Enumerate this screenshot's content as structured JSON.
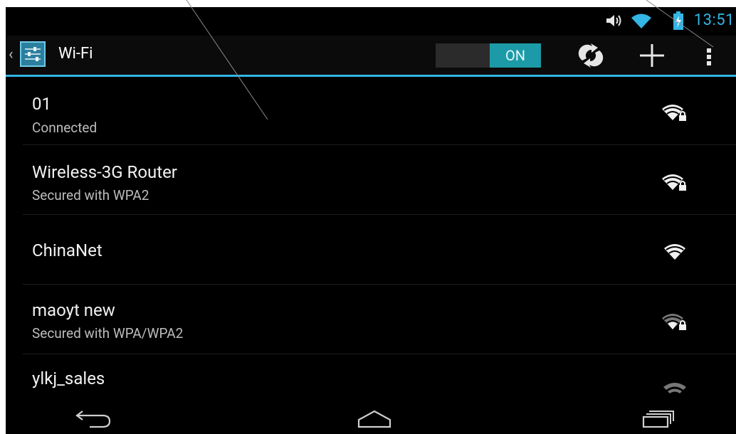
{
  "status_bar": {
    "time": "13:51",
    "icons": [
      "volume-icon",
      "wifi-signal-icon",
      "battery-charging-icon"
    ],
    "accent": "#33b5e5"
  },
  "action_bar": {
    "title": "Wi-Fi",
    "toggle_label": "ON",
    "toggle_state": "on",
    "buttons": [
      "wps-icon",
      "add-network-icon",
      "overflow-menu-icon"
    ]
  },
  "networks": [
    {
      "name": "01",
      "status": "Connected",
      "secured": true,
      "signal": "strong"
    },
    {
      "name": "Wireless-3G Router",
      "status": "Secured with WPA2",
      "secured": true,
      "signal": "strong"
    },
    {
      "name": "ChinaNet",
      "status": "",
      "secured": false,
      "signal": "strong"
    },
    {
      "name": "maoyt new",
      "status": "Secured with WPA/WPA2",
      "secured": true,
      "signal": "medium"
    },
    {
      "name": "ylkj_sales",
      "status": "",
      "secured": false,
      "signal": "weak"
    }
  ],
  "nav_bar": {
    "buttons": [
      "back-icon",
      "home-icon",
      "recent-apps-icon"
    ]
  },
  "colors": {
    "background": "#000000",
    "accent": "#33b5e5",
    "toggle_on": "#1c9aa7",
    "text_primary": "#f2f2f2",
    "text_secondary": "#bdbdbd"
  }
}
